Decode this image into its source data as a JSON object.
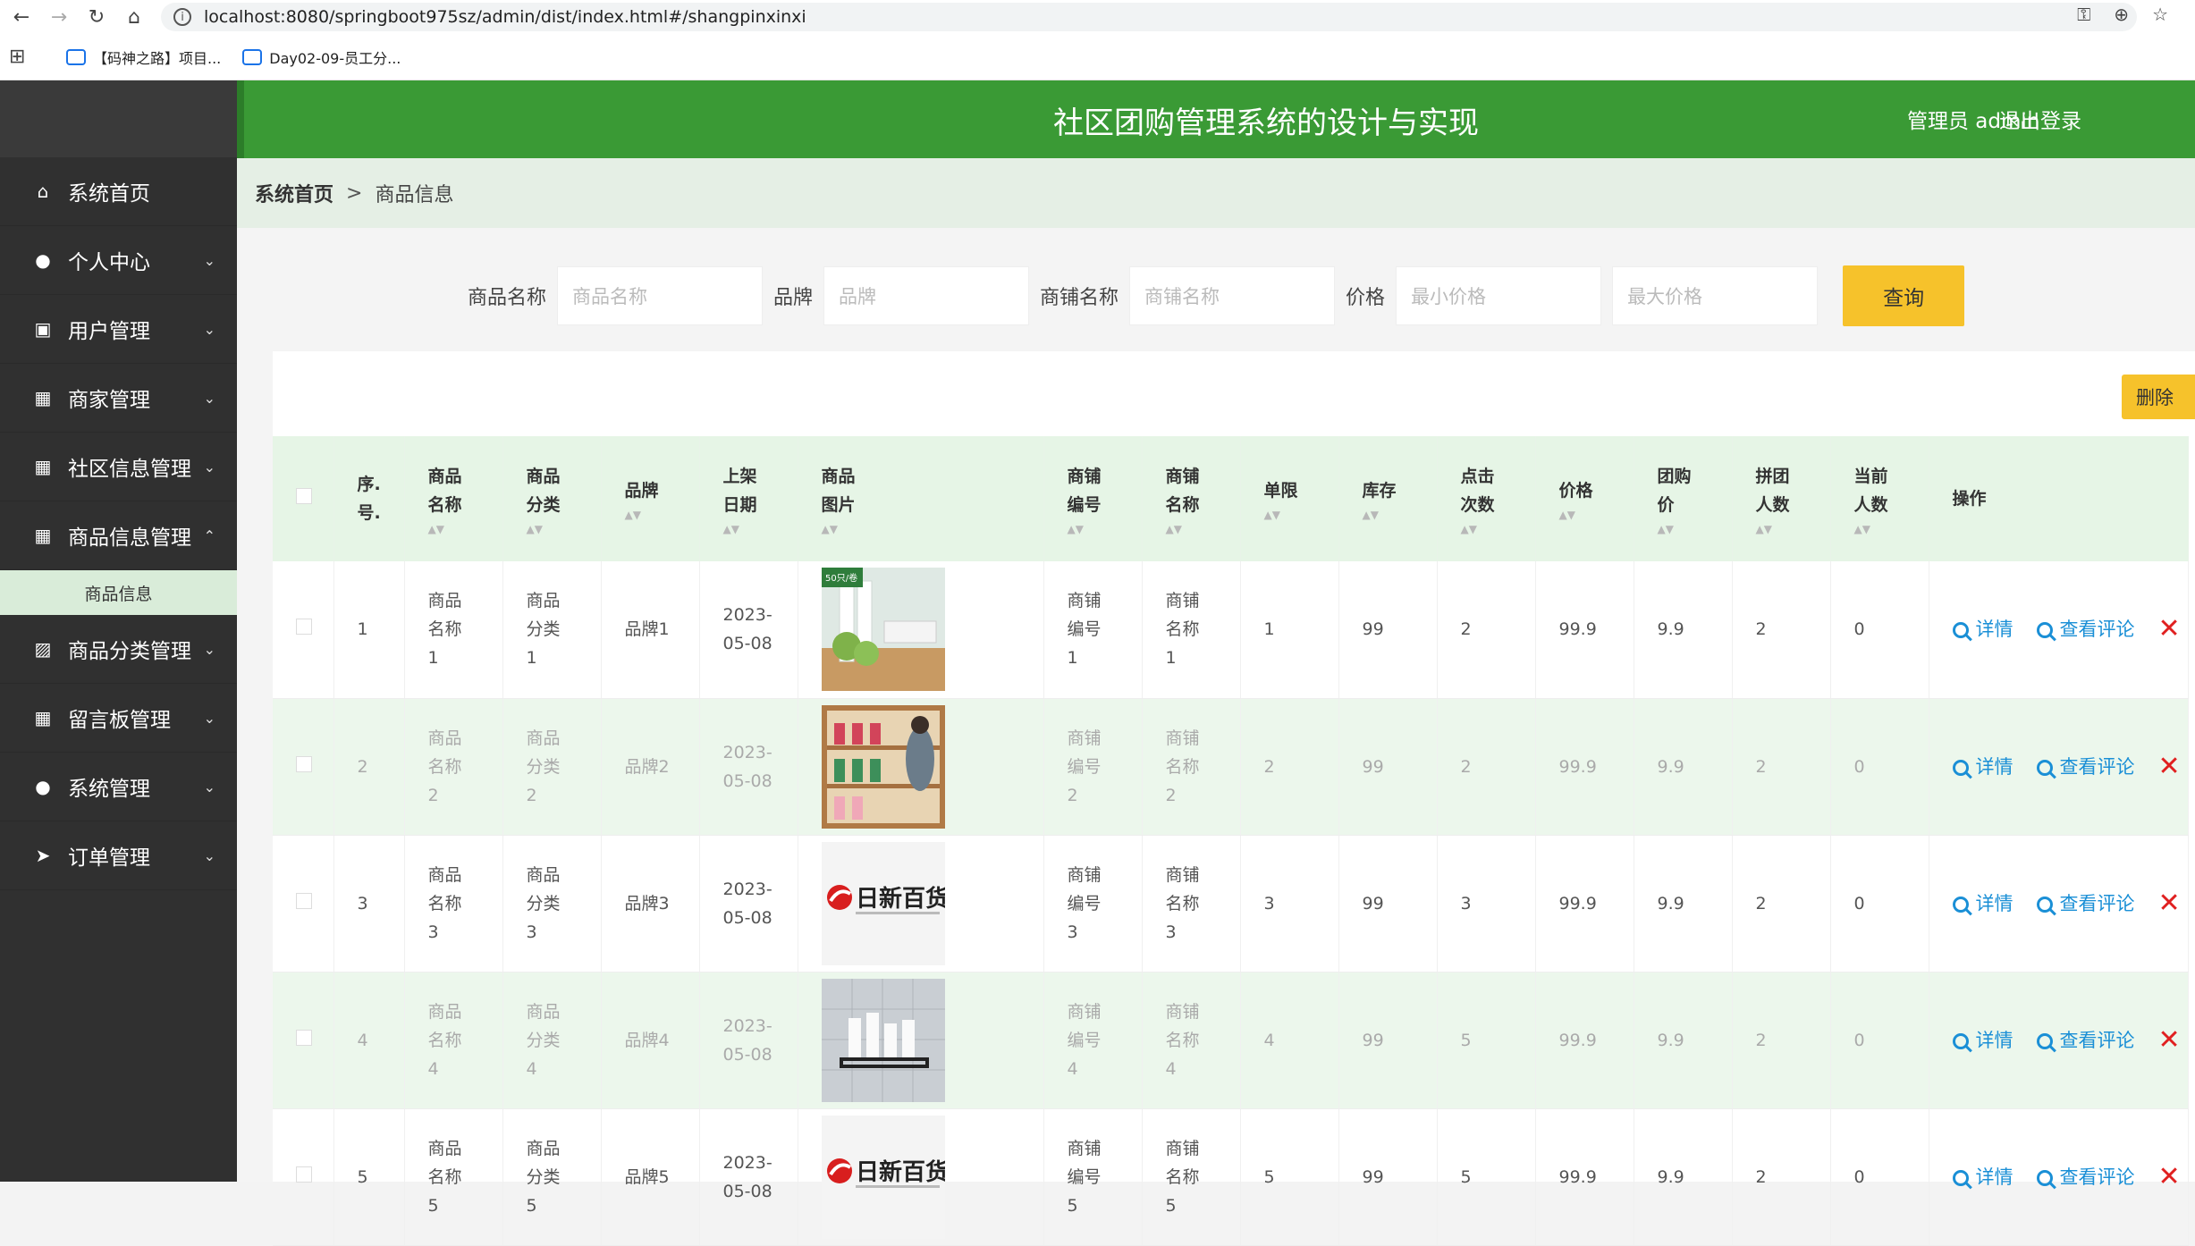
{
  "browser": {
    "url": "localhost:8080/springboot975sz/admin/dist/index.html#/shangpinxinxi",
    "bookmarks": [
      "【码神之路】项目...",
      "Day02-09-员工分..."
    ]
  },
  "header": {
    "title": "社区团购管理系统的设计与实现",
    "user": "管理员 admin",
    "logout": "退出登录"
  },
  "sidebar": {
    "items": [
      {
        "label": "系统首页",
        "icon": "home-icon",
        "chevron": ""
      },
      {
        "label": "个人中心",
        "icon": "user-icon",
        "chevron": "⌄"
      },
      {
        "label": "用户管理",
        "icon": "clipboard-icon",
        "chevron": "⌄"
      },
      {
        "label": "商家管理",
        "icon": "grid-icon",
        "chevron": "⌄"
      },
      {
        "label": "社区信息管理",
        "icon": "grid-icon",
        "chevron": "⌄"
      },
      {
        "label": "商品信息管理",
        "icon": "grid-icon",
        "chevron": "⌃"
      },
      {
        "label": "商品分类管理",
        "icon": "chart-icon",
        "chevron": "⌄"
      },
      {
        "label": "留言板管理",
        "icon": "grid-icon",
        "chevron": "⌄"
      },
      {
        "label": "系统管理",
        "icon": "bulb-icon",
        "chevron": "⌄"
      },
      {
        "label": "订单管理",
        "icon": "send-icon",
        "chevron": "⌄"
      }
    ],
    "submenu": "商品信息"
  },
  "breadcrumb": {
    "home": "系统首页",
    "sep": ">",
    "current": "商品信息"
  },
  "search": {
    "name_label": "商品名称",
    "name_placeholder": "商品名称",
    "brand_label": "品牌",
    "brand_placeholder": "品牌",
    "shop_label": "商铺名称",
    "shop_placeholder": "商铺名称",
    "price_label": "价格",
    "min_placeholder": "最小价格",
    "max_placeholder": "最大价格",
    "query": "查询"
  },
  "toolbar": {
    "delete": "删除"
  },
  "table": {
    "headers": [
      "序.号.",
      "商品名称",
      "商品分类",
      "品牌",
      "上架日期",
      "商品图片",
      "商铺编号",
      "商铺名称",
      "单限",
      "库存",
      "点击次数",
      "价格",
      "团购价",
      "拼团人数",
      "当前人数",
      "操作"
    ],
    "detail": "详情",
    "comments": "查看评论",
    "rows": [
      {
        "no": "1",
        "name": "商品名称1",
        "cat": "商品分类1",
        "brand": "品牌1",
        "date": "2023-05-08",
        "image": "wrap",
        "shop_no": "商铺编号1",
        "shop": "商铺名称1",
        "limit": "1",
        "stock": "99",
        "clicks": "2",
        "price": "99.9",
        "group_price": "9.9",
        "group_size": "2",
        "current": "0",
        "image_text": "50只/卷"
      },
      {
        "no": "2",
        "name": "商品名称2",
        "cat": "商品分类2",
        "brand": "品牌2",
        "date": "2023-05-08",
        "image": "shelf",
        "shop_no": "商铺编号2",
        "shop": "商铺名称2",
        "limit": "2",
        "stock": "99",
        "clicks": "2",
        "price": "99.9",
        "group_price": "9.9",
        "group_size": "2",
        "current": "0",
        "image_text": ""
      },
      {
        "no": "3",
        "name": "商品名称3",
        "cat": "商品分类3",
        "brand": "品牌3",
        "date": "2023-05-08",
        "image": "logo",
        "shop_no": "商铺编号3",
        "shop": "商铺名称3",
        "limit": "3",
        "stock": "99",
        "clicks": "3",
        "price": "99.9",
        "group_price": "9.9",
        "group_size": "2",
        "current": "0",
        "image_text": "日新百货"
      },
      {
        "no": "4",
        "name": "商品名称4",
        "cat": "商品分类4",
        "brand": "品牌4",
        "date": "2023-05-08",
        "image": "rack",
        "shop_no": "商铺编号4",
        "shop": "商铺名称4",
        "limit": "4",
        "stock": "99",
        "clicks": "5",
        "price": "99.9",
        "group_price": "9.9",
        "group_size": "2",
        "current": "0",
        "image_text": ""
      },
      {
        "no": "5",
        "name": "商品名称5",
        "cat": "商品分类5",
        "brand": "品牌5",
        "date": "2023-05-08",
        "image": "logo",
        "shop_no": "商铺编号5",
        "shop": "商铺名称5",
        "limit": "5",
        "stock": "99",
        "clicks": "5",
        "price": "99.9",
        "group_price": "9.9",
        "group_size": "2",
        "current": "0",
        "image_text": "日新百货"
      }
    ]
  },
  "colors": {
    "header": "#3a9a35",
    "sidebar": "#303030",
    "accent": "#f6c22b",
    "link": "#1a8fd6"
  }
}
